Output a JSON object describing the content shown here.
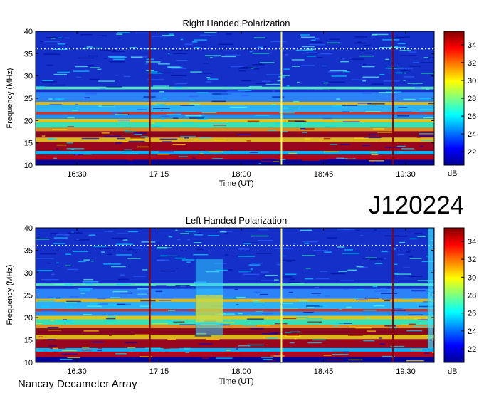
{
  "big_label": "J120224",
  "footer": "Nancay Decameter Array",
  "chart_data": [
    {
      "type": "heatmap",
      "title": "Right Handed Polarization",
      "xlabel": "Time (UT)",
      "ylabel": "Frequency (MHz)",
      "x_ticks": [
        "16:30",
        "17:15",
        "18:00",
        "18:45",
        "19:30"
      ],
      "y_ticks": [
        10,
        15,
        20,
        25,
        30,
        35,
        40
      ],
      "ylim": [
        10,
        40
      ],
      "colorbar": {
        "label": "dB",
        "ticks": [
          22,
          24,
          26,
          28,
          30,
          32,
          34
        ],
        "range": [
          20.5,
          35.5
        ]
      },
      "vertical_lines": [
        {
          "time": "17:10",
          "color": "#8b0000"
        },
        {
          "time": "18:22",
          "color": "#ffff66"
        },
        {
          "time": "19:23",
          "color": "#8b0000"
        }
      ]
    },
    {
      "type": "heatmap",
      "title": "Left Handed Polarization",
      "xlabel": "Time (UT)",
      "ylabel": "Frequency (MHz)",
      "x_ticks": [
        "16:30",
        "17:15",
        "18:00",
        "18:45",
        "19:30"
      ],
      "y_ticks": [
        10,
        15,
        20,
        25,
        30,
        35,
        40
      ],
      "ylim": [
        10,
        40
      ],
      "colorbar": {
        "label": "dB",
        "ticks": [
          22,
          24,
          26,
          28,
          30,
          32,
          34
        ],
        "range": [
          20.5,
          35.5
        ]
      },
      "vertical_lines": [
        {
          "time": "17:10",
          "color": "#8b0000"
        },
        {
          "time": "18:22",
          "color": "#ffff66"
        },
        {
          "time": "19:23",
          "color": "#8b0000"
        }
      ]
    }
  ]
}
